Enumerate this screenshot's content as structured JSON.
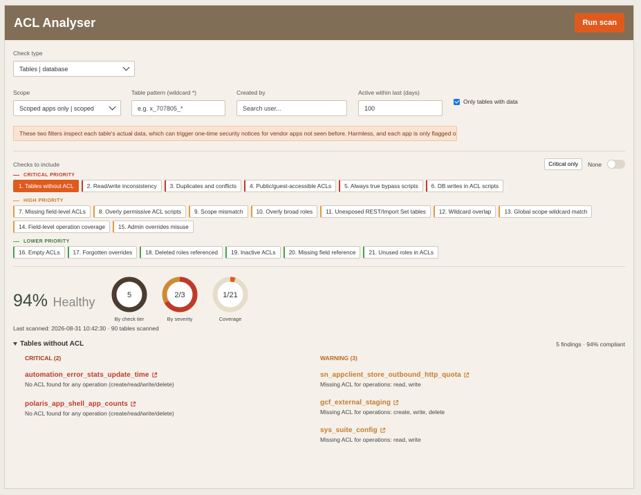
{
  "app": {
    "title": "ACL Analyser",
    "run_label": "Run scan"
  },
  "check_type": {
    "label": "Check type",
    "value": "Tables | database"
  },
  "filters": {
    "scope_label": "Scope",
    "scope_value": "Scoped apps only | scoped",
    "pattern_label": "Table pattern (wildcard *)",
    "pattern_placeholder": "e.g. x_707805_*",
    "created_label": "Created by",
    "created_placeholder": "Search user...",
    "active_label": "Active within last (days)",
    "active_value": "100",
    "only_data_label": "Only tables with data"
  },
  "notice": "These two filters inspect each table's actual data, which can trigger one-time security notices for vendor apps not seen before. Harmless, and each app is only flagged once.",
  "checks": {
    "label": "Checks to include",
    "critical_only": "Critical only",
    "none": "None",
    "critical_title": "CRITICAL PRIORITY",
    "high_title": "HIGH PRIORITY",
    "lower_title": "LOWER PRIORITY",
    "critical": [
      "1. Tables without ACL",
      "2. Read/write inconsistency",
      "3. Duplicates and conflicts",
      "4. Public/guest-accessible ACLs",
      "5. Always true bypass scripts",
      "6. DB writes in ACL scripts"
    ],
    "high": [
      "7. Missing field-level ACLs",
      "8. Overly permissive ACL scripts",
      "9. Scope mismatch",
      "10. Overly broad roles",
      "11. Unexposed REST/Import Set tables",
      "12. Wildcard overlap",
      "13. Global scope wildcard match",
      "14. Field-level operation coverage",
      "15. Admin overrides misuse"
    ],
    "lower": [
      "16. Empty ACLs",
      "17. Forgotten overrides",
      "18. Deleted roles referenced",
      "19. Inactive ACLs",
      "20. Missing field reference",
      "21. Unused roles in ACLs"
    ]
  },
  "health": {
    "percent": "94%",
    "word": "Healthy",
    "tier_value": "5",
    "tier_caption": "By check tier",
    "severity_value": "2/3",
    "severity_caption": "By severity",
    "severity_fraction": 0.667,
    "coverage_value": "1/21",
    "coverage_caption": "Coverage",
    "coverage_fraction": 0.048,
    "last_scanned": "Last scanned: 2026-08-31 10:42:30 · 90 tables scanned"
  },
  "results": {
    "section_title": "Tables without ACL",
    "summary": "5 findings · 94% compliant",
    "critical_title": "CRITICAL (2)",
    "warning_title": "WARNING (3)",
    "critical": [
      {
        "name": "automation_error_stats_update_time",
        "desc": "No ACL found for any operation (create/read/write/delete)"
      },
      {
        "name": "polaris_app_shell_app_counts",
        "desc": "No ACL found for any operation (create/read/write/delete)"
      }
    ],
    "warning": [
      {
        "name": "sn_appclient_store_outbound_http_quota",
        "desc": "Missing ACL for operations: read, write"
      },
      {
        "name": "gcf_external_staging",
        "desc": "Missing ACL for operations: create, write, delete"
      },
      {
        "name": "sys_suite_config",
        "desc": "Missing ACL for operations: read, write"
      }
    ]
  },
  "colors": {
    "accent": "#e05a1e",
    "header": "#806f56",
    "critical": "#c0392b",
    "warning": "#c87a2a",
    "lower": "#3fa34d",
    "donut_dark": "#4a3d30"
  }
}
